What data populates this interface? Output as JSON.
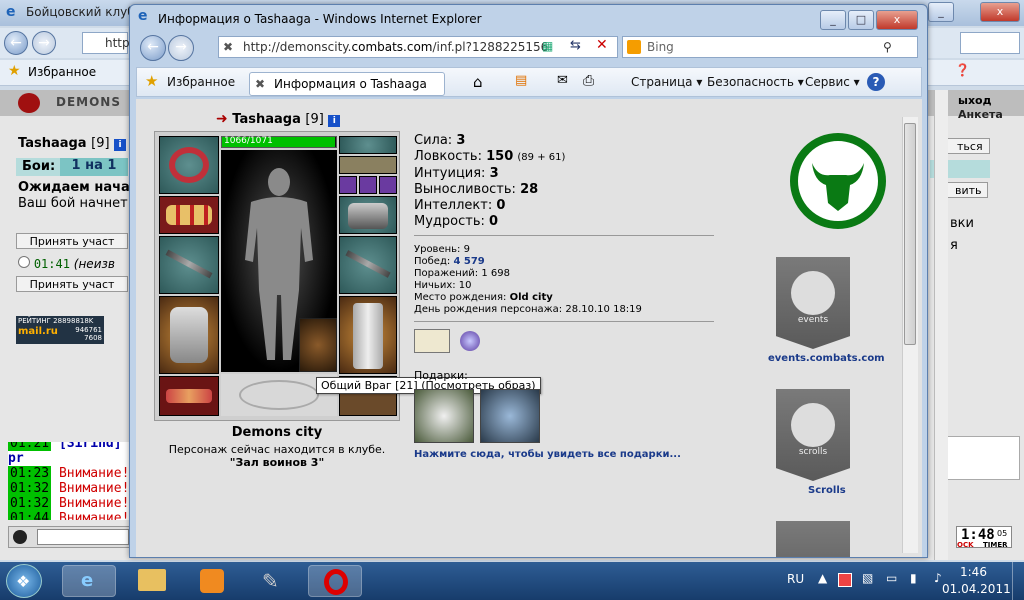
{
  "bg": {
    "title": "Бойцовский клуб",
    "address": "http",
    "favorites": "Избранное",
    "header_brand": "DEMONS",
    "right_top": "ыход",
    "right_tab": "Анкета",
    "right_btn1": "ться",
    "right_btn2": "вить",
    "right_text1": "вки",
    "right_text2": "я",
    "player_name": "Tashaaga",
    "player_level": "[9]",
    "fights_label": "Бои:",
    "fights_value": "1 на 1",
    "waiting": "Ожидаем начал",
    "your_fight": "Ваш бой начнет",
    "accept1": "Принять участ",
    "timer_prefix": "01:41",
    "timer_suffix": "(неизв",
    "accept2": "Принять участ",
    "rating_label": "РЕЙТИНГ",
    "rating_value": "28898818K",
    "mailru": "mail.ru",
    "mail_n1": "946761",
    "mail_n2": "7608",
    "log": [
      {
        "time": "01:21",
        "text": "[Sirind] pr"
      },
      {
        "time": "01:23",
        "text": "Внимание!"
      },
      {
        "time": "01:32",
        "text": "Внимание!"
      },
      {
        "time": "01:32",
        "text": "Внимание!"
      },
      {
        "time": "01:44",
        "text": "Внимание!"
      }
    ],
    "clock": "1:48",
    "clock_sec": "05",
    "clock_lbl1": "OCK",
    "clock_lbl2": "TIMER"
  },
  "popup": {
    "title": "Информация о Tashaaga - Windows Internet Explorer",
    "url_prefix": "http://demonscity.",
    "url_domain": "combats.com",
    "url_rest": "/inf.pl?1288225156",
    "search_placeholder": "Bing",
    "favorites": "Избранное",
    "tab_title": "Информация о Tashaaga",
    "menu_page": "Страница",
    "menu_security": "Безопасность",
    "menu_service": "Сервис",
    "menu_help": "?"
  },
  "character": {
    "name": "Tashaaga",
    "level": "[9]",
    "hp": "1066/1071",
    "hp_fraction": 0.995,
    "city": "Demons city",
    "location_line": "Персонаж сейчас находится в клубе.",
    "location_room": "\"Зал воинов 3\"",
    "tooltip": "Общий Враг [21] (Посмотреть образ)"
  },
  "stats": [
    {
      "label": "Сила:",
      "value": "3",
      "extra": ""
    },
    {
      "label": "Ловкость:",
      "value": "150",
      "extra": "(89 + 61)"
    },
    {
      "label": "Интуиция:",
      "value": "3",
      "extra": ""
    },
    {
      "label": "Выносливость:",
      "value": "28",
      "extra": ""
    },
    {
      "label": "Интеллект:",
      "value": "0",
      "extra": ""
    },
    {
      "label": "Мудрость:",
      "value": "0",
      "extra": ""
    }
  ],
  "info": {
    "level": "Уровень: 9",
    "wins_label": "Побед:",
    "wins_value": "4 579",
    "losses": "Поражений: 1 698",
    "draws": "Ничьих: 10",
    "birthplace_label": "Место рождения:",
    "birthplace_value": "Old city",
    "birthday_label": "День рождения персонажа:",
    "birthday_value": "28.10.10 18:19"
  },
  "gifts": {
    "label": "Подарки:",
    "link": "Нажмите сюда, чтобы увидеть все подарки..."
  },
  "side": {
    "events_link": "events.combats.com",
    "events_caption": "events",
    "scrolls_link": "Scrolls",
    "scrolls_caption": "scrolls"
  },
  "taskbar": {
    "lang": "RU",
    "time": "1:46",
    "date": "01.04.2011"
  },
  "colors": {
    "green_emblem": "#0a7a14",
    "hp_green": "#00c000",
    "link_blue": "#1a3a8a"
  }
}
